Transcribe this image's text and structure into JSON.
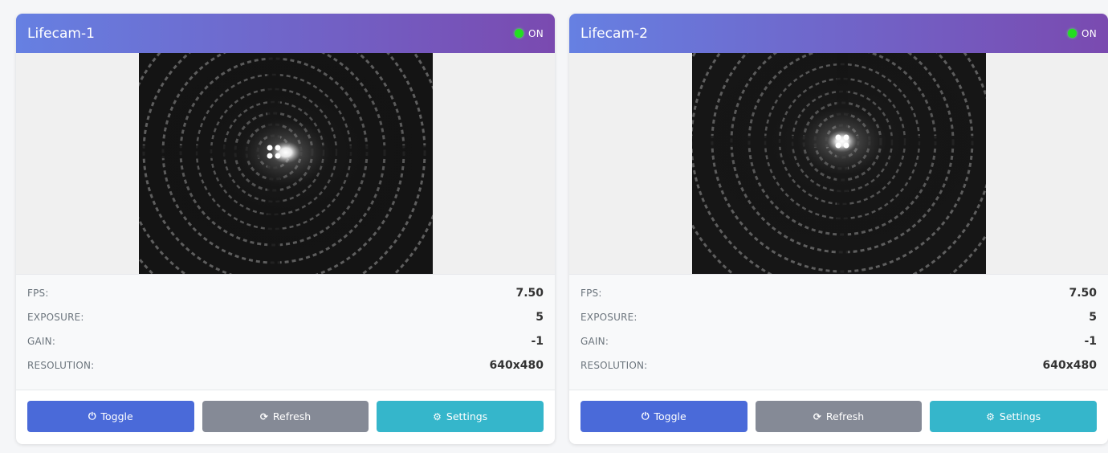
{
  "cameras": [
    {
      "name": "Lifecam-1",
      "status": "ON",
      "stats": [
        {
          "label": "FPS:",
          "value": "7.50"
        },
        {
          "label": "EXPOSURE:",
          "value": "5"
        },
        {
          "label": "GAIN:",
          "value": "-1"
        },
        {
          "label": "RESOLUTION:",
          "value": "640x480"
        }
      ],
      "buttons": {
        "toggle": "Toggle",
        "refresh": "Refresh",
        "settings": "Settings"
      }
    },
    {
      "name": "Lifecam-2",
      "status": "ON",
      "stats": [
        {
          "label": "FPS:",
          "value": "7.50"
        },
        {
          "label": "EXPOSURE:",
          "value": "5"
        },
        {
          "label": "GAIN:",
          "value": "-1"
        },
        {
          "label": "RESOLUTION:",
          "value": "640x480"
        }
      ],
      "buttons": {
        "toggle": "Toggle",
        "refresh": "Refresh",
        "settings": "Settings"
      }
    }
  ],
  "icons": {
    "toggle": "power-icon",
    "refresh": "refresh-icon",
    "settings": "gear-icon"
  },
  "colors": {
    "header_start": "#6680e2",
    "header_end": "#7a4ab0",
    "status_on": "#22e020",
    "toggle": "#4a6ad9",
    "refresh": "#858a96",
    "settings": "#35b6cb"
  }
}
